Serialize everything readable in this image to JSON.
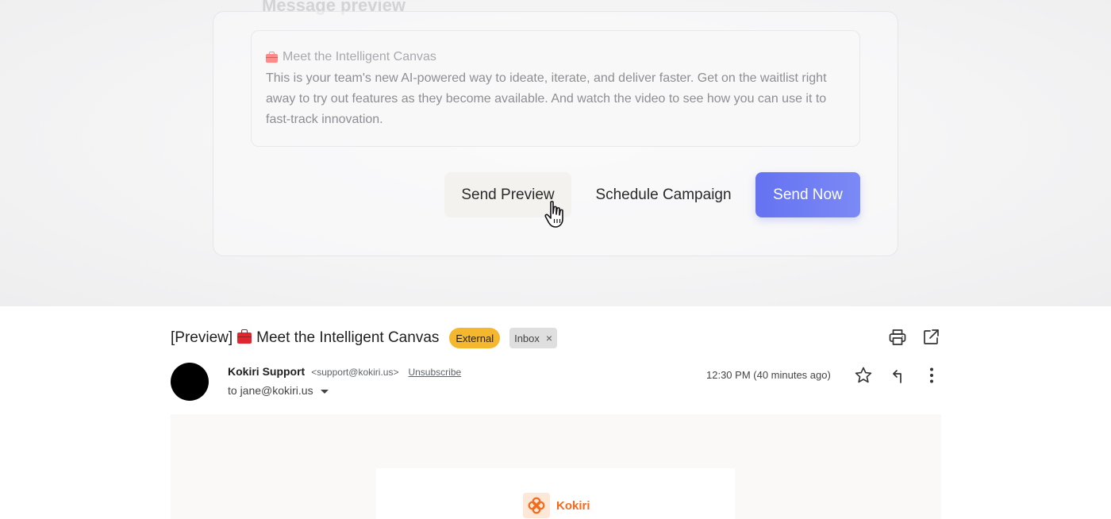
{
  "composer": {
    "title": "Message preview",
    "preview_subject": "Meet the Intelligent Canvas",
    "preview_body": "This is your team's new AI-powered way to ideate, iterate, and deliver faster. Get on the waitlist right away to try out features as they become available. And watch the video to see how you can use it to fast-track innovation.",
    "buttons": {
      "send_preview": "Send Preview",
      "schedule": "Schedule Campaign",
      "send_now": "Send Now"
    },
    "accent_color": "#6572f2"
  },
  "email": {
    "subject_prefix": "[Preview]",
    "subject": "Meet the Intelligent Canvas",
    "labels": {
      "external": "External",
      "inbox": "Inbox",
      "inbox_remove": "×"
    },
    "sender_name": "Kokiri Support",
    "sender_email": "<support@kokiri.us>",
    "unsubscribe": "Unsubscribe",
    "to": "to jane@kokiri.us",
    "timestamp": "12:30 PM (40 minutes ago)",
    "brand_name": "Kokiri",
    "brand_color": "#f26b1d",
    "external_badge_color": "#f4b72e",
    "icons": [
      "print-icon",
      "open-in-new-icon",
      "star-icon",
      "reply-icon",
      "more-vertical-icon",
      "toolbox-emoji-icon",
      "kokiri-logo-icon",
      "hand-pointer-cursor-icon"
    ]
  }
}
